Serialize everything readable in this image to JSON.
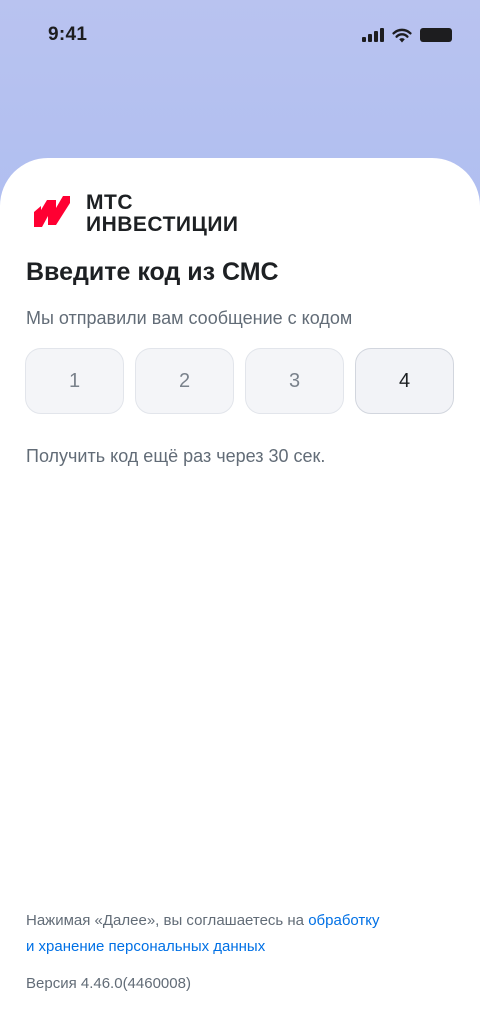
{
  "status_bar": {
    "time": "9:41"
  },
  "brand": {
    "line1": "МТС",
    "line2": "ИНВЕСТИЦИИ",
    "logo_color": "#ff0032"
  },
  "title": "Введите код из СМС",
  "subtitle": "Мы отправили вам сообщение с кодом",
  "code": {
    "digits": [
      "1",
      "2",
      "3",
      "4"
    ]
  },
  "resend_text": "Получить код ещё раз через 30 сек.",
  "consent": {
    "prefix": "Нажимая «Далее», вы соглашаетесь на ",
    "link_part1": "обработку",
    "link_part2": "и хранение персональных данных"
  },
  "version": "Версия 4.46.0(4460008)",
  "colors": {
    "accent": "#0070e5",
    "text_primary": "#1d2023",
    "text_secondary": "#626c77"
  }
}
